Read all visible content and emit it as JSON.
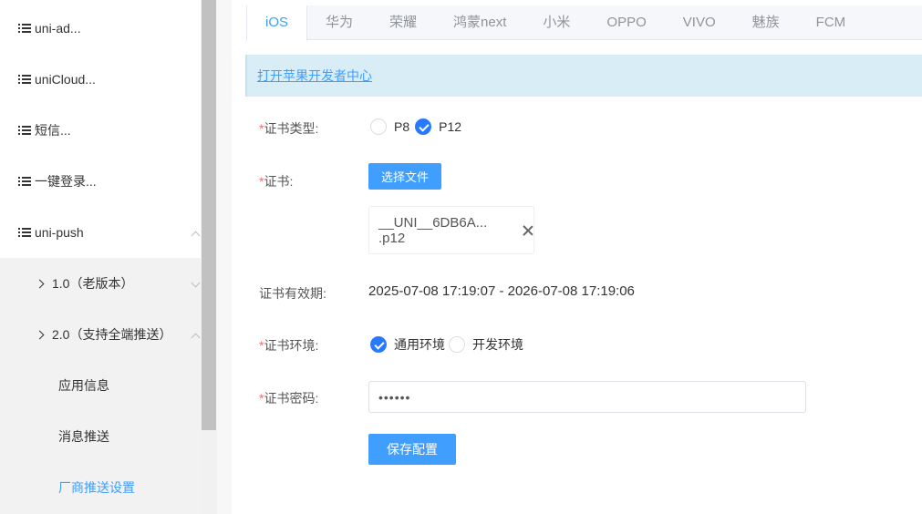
{
  "sidebar": {
    "items": [
      {
        "label": "uni-ad..."
      },
      {
        "label": "uniCloud..."
      },
      {
        "label": "短信..."
      },
      {
        "label": "一键登录..."
      },
      {
        "label": "uni-push"
      }
    ],
    "sub_items": [
      {
        "label": "1.0（老版本）"
      },
      {
        "label": "2.0（支持全端推送）"
      }
    ],
    "leaf_items": [
      {
        "label": "应用信息"
      },
      {
        "label": "消息推送"
      },
      {
        "label": "厂商推送设置"
      }
    ]
  },
  "tabs": [
    {
      "label": "iOS"
    },
    {
      "label": "华为"
    },
    {
      "label": "荣耀"
    },
    {
      "label": "鸿蒙next"
    },
    {
      "label": "小米"
    },
    {
      "label": "OPPO"
    },
    {
      "label": "VIVO"
    },
    {
      "label": "魅族"
    },
    {
      "label": "FCM"
    }
  ],
  "banner": {
    "link_text": "打开苹果开发者中心"
  },
  "form": {
    "required_mark": "*",
    "cert_type": {
      "label": "证书类型:",
      "options": [
        "P8",
        "P12"
      ],
      "selected": "P12"
    },
    "cert": {
      "label": "证书:",
      "button": "选择文件",
      "file_name": "__UNI__6DB6A... .p12"
    },
    "validity": {
      "label": "证书有效期:",
      "value": "2025-07-08 17:19:07 - 2026-07-08 17:19:06"
    },
    "env": {
      "label": "证书环境:",
      "options": [
        "通用环境",
        "开发环境"
      ],
      "selected": "通用环境"
    },
    "password": {
      "label": "证书密码:",
      "value": "••••••"
    },
    "save_button": "保存配置"
  },
  "colors": {
    "accent": "#409eff",
    "radio_checked": "#2979ff",
    "required": "#f56c6c",
    "banner_bg": "#d9edf6"
  }
}
